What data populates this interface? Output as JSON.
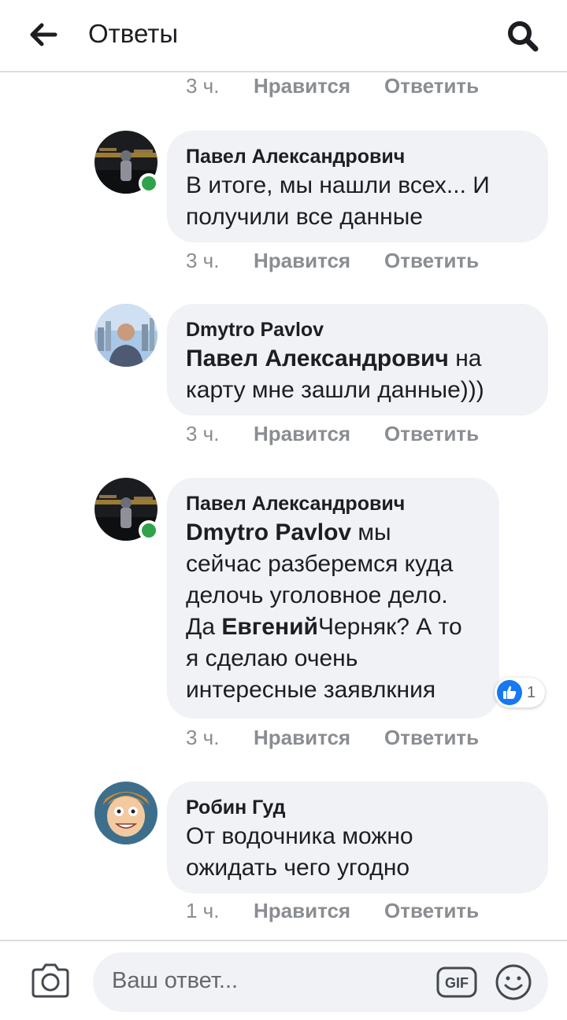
{
  "header": {
    "title": "Ответы",
    "back_icon": "arrow-left-icon",
    "search_icon": "search-icon"
  },
  "top_actions": {
    "time": "3 ч.",
    "like": "Нравится",
    "reply": "Ответить"
  },
  "comments": [
    {
      "author": "Павел Александрович",
      "online": true,
      "lines": [
        "В итоге, мы нашли всех... И",
        "получили все данные"
      ],
      "time": "3 ч.",
      "like": "Нравится",
      "reply": "Ответить"
    },
    {
      "author": "Dmytro Pavlov",
      "online": false,
      "mention": "Павел Александрович",
      "line1_rest": " на",
      "line2": "карту мне зашли данные)))",
      "time": "3 ч.",
      "like": "Нравится",
      "reply": "Ответить"
    },
    {
      "author": "Павел Александрович",
      "online": true,
      "mention": "Dmytro Pavlov",
      "line1_rest": " мы",
      "line2": "сейчас разберемся куда",
      "line3": "делочь уголовное дело.",
      "line4_prefix": "Да ",
      "line4_mention": "Евгений",
      "line4_rest": "Черняк? А то",
      "line5": "я сделаю очень",
      "line6": "интересные заявлкния",
      "reactions": {
        "icon": "like-icon",
        "count": "1"
      },
      "time": "3 ч.",
      "like": "Нравится",
      "reply": "Ответить"
    },
    {
      "author": "Робин Гуд",
      "online": false,
      "lines": [
        "От водочника можно",
        "ожидать чего угодно"
      ],
      "time": "1 ч.",
      "like": "Нравится",
      "reply": "Ответить"
    }
  ],
  "composer": {
    "placeholder": "Ваш ответ...",
    "camera_icon": "camera-icon",
    "gif_label": "GIF",
    "emoji_icon": "emoji-icon"
  },
  "colors": {
    "bubble": "#f0f2f5",
    "online": "#31a24c",
    "action_text": "#8a8d91",
    "like_blue": "#1877f2"
  }
}
